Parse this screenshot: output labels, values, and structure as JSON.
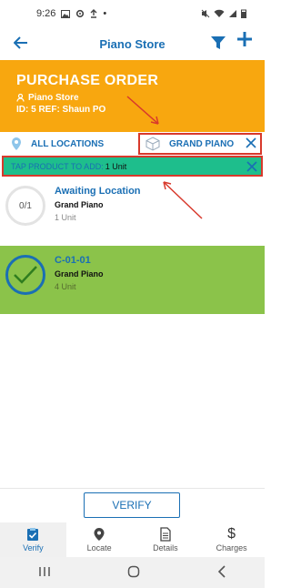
{
  "status_bar": {
    "time": "9:26"
  },
  "header": {
    "title": "Piano Store"
  },
  "order": {
    "title": "PURCHASE ORDER",
    "store": "Piano Store",
    "reference": "ID: 5 REF: Shaun PO"
  },
  "filters": {
    "all_locations": "ALL LOCATIONS",
    "product": "GRAND PIANO"
  },
  "tap_bar": {
    "label": "TAP PRODUCT TO ADD:",
    "value": "1 Unit"
  },
  "items": [
    {
      "progress": "0/1",
      "location": "Awaiting Location",
      "product": "Grand Piano",
      "quantity": "1 Unit"
    },
    {
      "location": "C-01-01",
      "product": "Grand Piano",
      "quantity": "4 Unit"
    }
  ],
  "verify_label": "VERIFY",
  "nav": [
    {
      "label": "Verify",
      "icon": "clipboard-check-icon"
    },
    {
      "label": "Locate",
      "icon": "location-pin-icon"
    },
    {
      "label": "Details",
      "icon": "document-icon"
    },
    {
      "label": "Charges",
      "icon": "dollar-icon"
    }
  ],
  "colors": {
    "accent": "#1a6fb4",
    "order_header": "#f8a70f",
    "tap_bar": "#1ebe8c",
    "completed_row": "#8bc34a",
    "annotation": "#d8392c"
  }
}
